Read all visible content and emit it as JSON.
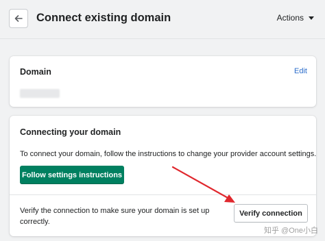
{
  "header": {
    "title": "Connect existing domain",
    "actions_label": "Actions",
    "back_icon": "arrow-left-icon",
    "actions_icon": "caret-down-icon"
  },
  "domain_card": {
    "title": "Domain",
    "edit_label": "Edit"
  },
  "connect_card": {
    "title": "Connecting your domain",
    "instructions": "To connect your domain, follow the instructions to change your provider account settings.",
    "follow_button_label": "Follow settings instructions",
    "verify_text": "Verify the connection to make sure your domain is set up correctly.",
    "verify_button_label": "Verify connection"
  },
  "annotation": {
    "arrow_color": "#e0282e"
  },
  "watermark": "知乎 @One小白",
  "colors": {
    "primary_button": "#008060",
    "link": "#2c6ecb",
    "background": "#f1f2f3"
  }
}
